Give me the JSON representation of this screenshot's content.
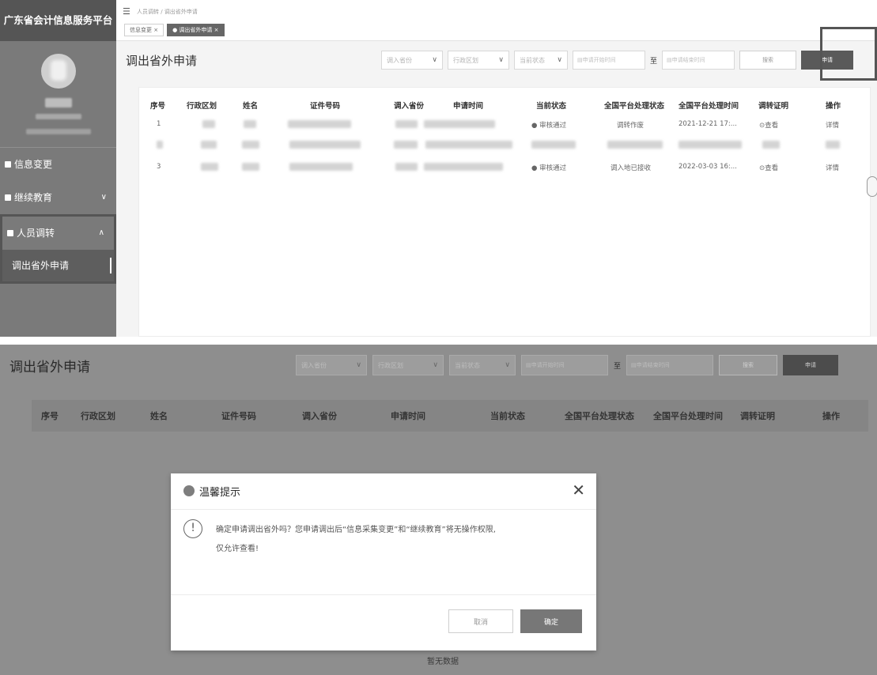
{
  "brand": "广东省会计信息服务平台",
  "sidebar": {
    "menu": [
      {
        "label": "信息变更",
        "chevron": ""
      },
      {
        "label": "继续教育",
        "chevron": "∨"
      },
      {
        "label": "人员调转",
        "chevron": "∧"
      }
    ],
    "submenu_active": "调出省外申请"
  },
  "topbar": {
    "toggle_icon": "☰",
    "breadcrumb": "人员调转 / 调出省外申请",
    "tabs": [
      "信息变更 ×",
      "● 调出省外申请 ×"
    ]
  },
  "page_title": "调出省外申请",
  "filters": {
    "province": "调入省份",
    "region": "行政区划",
    "status": "当前状态",
    "date_start": "申请开始时间",
    "to": "至",
    "date_end": "申请结束时间",
    "search_btn": "搜索",
    "apply_btn": "申请"
  },
  "table": {
    "headers": [
      "序号",
      "行政区划",
      "姓名",
      "证件号码",
      "调入省份",
      "申请时间",
      "当前状态",
      "全国平台处理状态",
      "全国平台处理时间",
      "调转证明",
      "操作"
    ],
    "rows": [
      {
        "no": "1",
        "status": "● 审核通过",
        "platform_status": "调转作废",
        "platform_time": "2021-12-21 17:...",
        "proof": "⊙查看",
        "op": "详情"
      },
      {
        "no": "3",
        "status": "● 审核通过",
        "platform_status": "调入地已接收",
        "platform_time": "2022-03-03 16:...",
        "proof": "⊙查看",
        "op": "详情"
      }
    ]
  },
  "bottom": {
    "no_data": "暂无数据"
  },
  "modal": {
    "title": "温馨提示",
    "close": "✕",
    "warn_icon": "!",
    "message_line1": "确定申请调出省外吗？您申请调出后“信息采集变更”和“继续教育”将无操作权限,",
    "message_line2": "仅允许查看!",
    "cancel": "取消",
    "confirm": "确定"
  }
}
